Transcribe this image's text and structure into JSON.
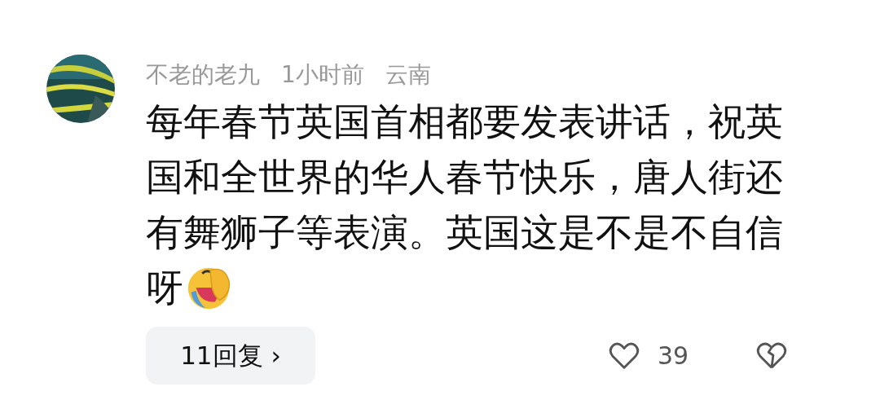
{
  "comment": {
    "author": "不老的老九",
    "time": "1小时前",
    "location": "云南",
    "lines": [
      "每年春节英国首相都要发表讲话，祝英",
      "国和全世界的华人春节快乐，唐人街还",
      "有舞狮子等表演。英国这是不是不自信",
      "呀"
    ],
    "replies_button": "11回复 ›",
    "like_count": "39",
    "liked": false
  }
}
